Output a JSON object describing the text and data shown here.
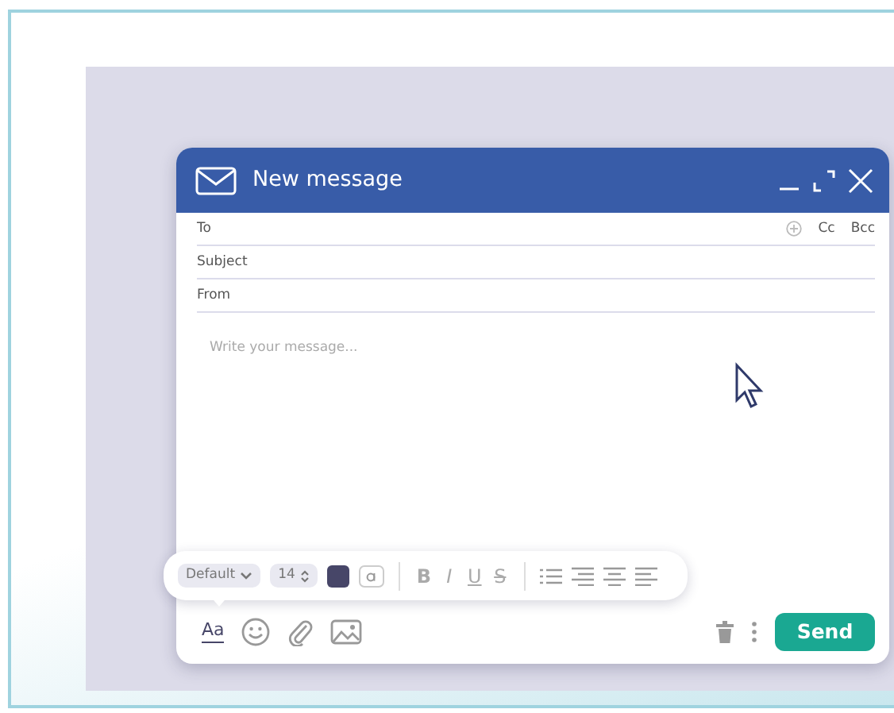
{
  "window": {
    "title": "New message"
  },
  "fields": [
    {
      "label": "To"
    },
    {
      "label": "Subject"
    },
    {
      "label": "From"
    }
  ],
  "recipient_options": [
    "Cc",
    "Bcc"
  ],
  "body": {
    "placeholder": "Write your message..."
  },
  "format_toolbar": {
    "open": true,
    "font": "Default",
    "size": "14",
    "style_buttons": [
      "B",
      "I",
      "U",
      "S"
    ]
  },
  "footer": {
    "format_button": "Aa",
    "send_label": "Send"
  }
}
